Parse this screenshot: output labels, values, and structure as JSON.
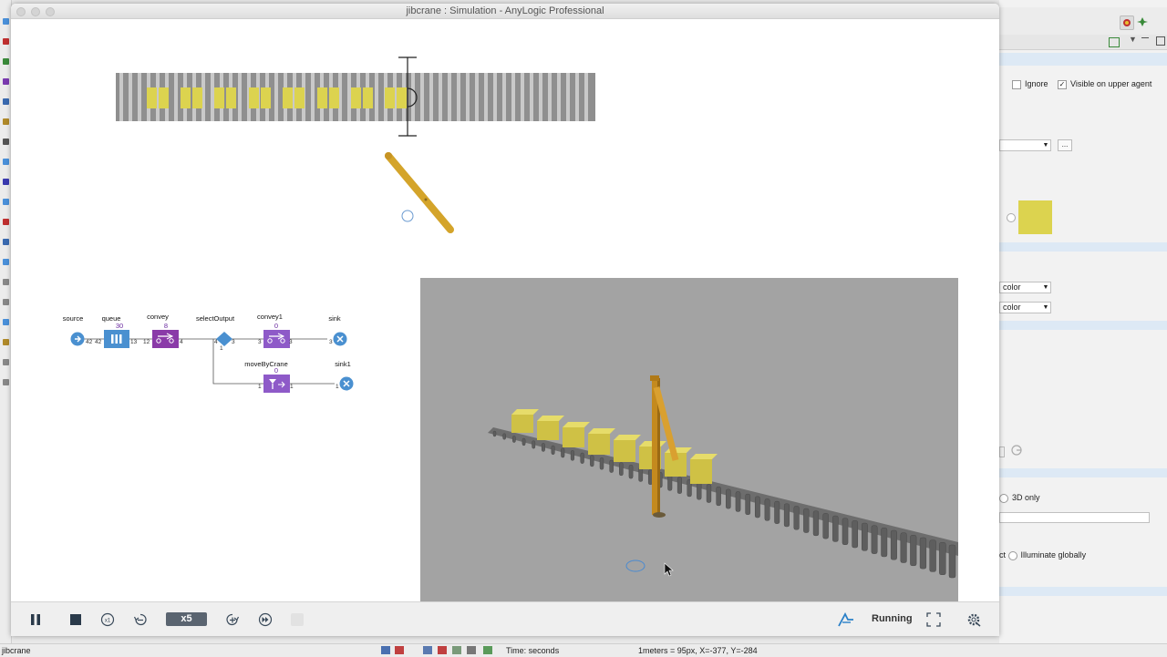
{
  "window": {
    "title": "jibcrane : Simulation - AnyLogic Professional",
    "background_title": "AnyLogic Professional"
  },
  "properties_panel": {
    "ignore_label": "Ignore",
    "visible_upper_label": "Visible on upper agent",
    "visible_upper_checked": true,
    "ellipsis_button": "...",
    "color_dropdown_1": "color",
    "color_dropdown_2": "color",
    "three_d_only_label": "3D only",
    "illuminate_prefix": "ct",
    "illuminate_label": "Illuminate globally",
    "swatch_color": "#dcd34f"
  },
  "flowchart": {
    "blocks": [
      {
        "id": "source",
        "label": "source"
      },
      {
        "id": "queue",
        "label": "queue",
        "count": "30"
      },
      {
        "id": "convey",
        "label": "convey",
        "count": "8"
      },
      {
        "id": "selectOutput",
        "label": "selectOutput"
      },
      {
        "id": "convey1",
        "label": "convey1",
        "count": "0"
      },
      {
        "id": "sink",
        "label": "sink"
      },
      {
        "id": "moveByCrane",
        "label": "moveByCrane",
        "count": "0"
      },
      {
        "id": "sink1",
        "label": "sink1"
      }
    ],
    "ports": {
      "source_out": "42",
      "queue_in": "42",
      "queue_out": "13",
      "convey_in": "12",
      "convey_out": "4",
      "select_in": "4",
      "select_out": "3",
      "select_out2": "1",
      "convey1_in": "3",
      "convey1_out": "3",
      "sink_in": "3",
      "crane_in": "1",
      "crane_out": "1",
      "sink1_in": "1"
    }
  },
  "toolbar": {
    "pause_icon": "pause-icon",
    "stop_icon": "stop-icon",
    "speed_label": "x5",
    "status": "Running"
  },
  "statusbar": {
    "model_name": "jibcrane",
    "time_units": "Time: seconds",
    "scale_info": "1meters = 95px, X=-377, Y=-284"
  }
}
